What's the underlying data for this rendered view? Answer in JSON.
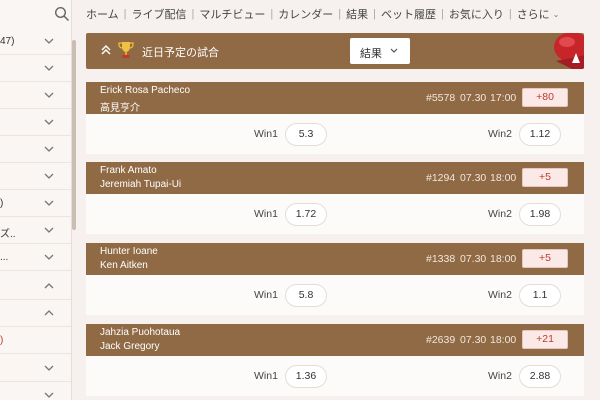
{
  "sidebar": {
    "items": [
      {
        "label": "47)",
        "red": false,
        "chevron": "down"
      },
      {
        "label": "",
        "red": false,
        "chevron": "down"
      },
      {
        "label": "",
        "red": false,
        "chevron": "down"
      },
      {
        "label": "",
        "red": false,
        "chevron": "down"
      },
      {
        "label": "",
        "red": false,
        "chevron": "down"
      },
      {
        "label": "",
        "red": false,
        "chevron": "down"
      },
      {
        "label": ")",
        "red": false,
        "chevron": "down"
      },
      {
        "label": "ズ..",
        "red": false,
        "chevron": "down"
      },
      {
        "label": "...",
        "red": false,
        "chevron": "down"
      },
      {
        "label": "",
        "red": false,
        "chevron": "up"
      },
      {
        "label": "",
        "red": false,
        "chevron": "up"
      },
      {
        "label": ")",
        "red": true,
        "chevron": "none"
      },
      {
        "label": "",
        "red": false,
        "chevron": "down"
      },
      {
        "label": "",
        "red": false,
        "chevron": "down"
      }
    ]
  },
  "nav": {
    "items": [
      "ホーム",
      "ライブ配信",
      "マルチビュー",
      "カレンダー",
      "結果",
      "ベット履歴",
      "お気に入り"
    ],
    "more": "さらに"
  },
  "header": {
    "title": "近日予定の試合",
    "select_value": "結果"
  },
  "matches": [
    {
      "p1": "Erick Rosa Pacheco",
      "p2": "高見亨介",
      "code": "#5578",
      "date": "07.30",
      "time": "17:00",
      "plus": "+80",
      "win1_label": "Win1",
      "win1": "5.3",
      "win2_label": "Win2",
      "win2": "1.12"
    },
    {
      "p1": "Frank Amato",
      "p2": "Jeremiah Tupai-Ui",
      "code": "#1294",
      "date": "07.30",
      "time": "18:00",
      "plus": "+5",
      "win1_label": "Win1",
      "win1": "1.72",
      "win2_label": "Win2",
      "win2": "1.98"
    },
    {
      "p1": "Hunter Ioane",
      "p2": "Ken Aitken",
      "code": "#1338",
      "date": "07.30",
      "time": "18:00",
      "plus": "+5",
      "win1_label": "Win1",
      "win1": "5.8",
      "win2_label": "Win2",
      "win2": "1.1"
    },
    {
      "p1": "Jahzia Puohotaua",
      "p2": "Jack Gregory",
      "code": "#2639",
      "date": "07.30",
      "time": "18:00",
      "plus": "+21",
      "win1_label": "Win1",
      "win1": "1.36",
      "win2_label": "Win2",
      "win2": "2.88"
    }
  ],
  "colors": {
    "accent_brown": "#8f6a45",
    "odds_plus_red": "#c0392b",
    "background": "#f6f1ee"
  },
  "icons": {
    "search": "search-icon",
    "collapse": "chevron-up-double-icon",
    "trophy": "trophy-icon",
    "boxing_glove": "boxing-glove-icon"
  }
}
